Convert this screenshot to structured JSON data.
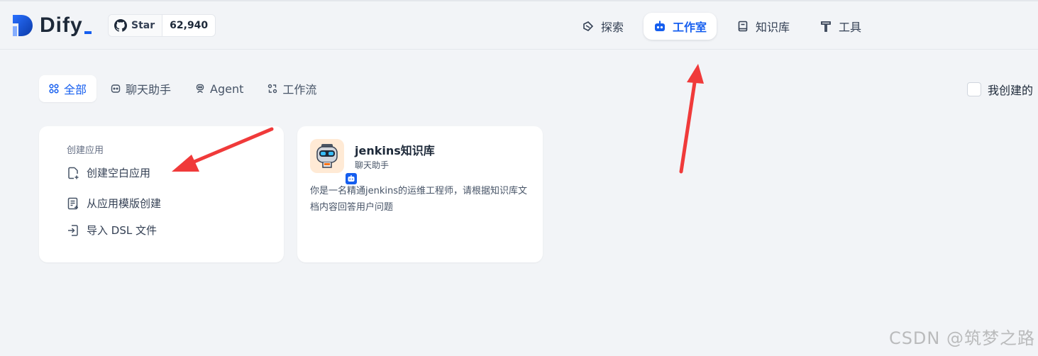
{
  "header": {
    "logo_text": "Dify",
    "github": {
      "star_label": "Star",
      "star_count": "62,940"
    },
    "nav": [
      {
        "label": "探索",
        "icon": "compass-icon",
        "active": false
      },
      {
        "label": "工作室",
        "icon": "robot-icon",
        "active": true
      },
      {
        "label": "知识库",
        "icon": "book-icon",
        "active": false
      },
      {
        "label": "工具",
        "icon": "hammer-icon",
        "active": false
      }
    ]
  },
  "tabs": [
    {
      "label": "全部",
      "icon": "grid-icon",
      "active": true
    },
    {
      "label": "聊天助手",
      "icon": "chat-icon",
      "active": false
    },
    {
      "label": "Agent",
      "icon": "agent-icon",
      "active": false
    },
    {
      "label": "工作流",
      "icon": "workflow-icon",
      "active": false
    }
  ],
  "filter": {
    "mine_label": "我创建的",
    "checked": false
  },
  "create_card": {
    "title": "创建应用",
    "items": [
      {
        "label": "创建空白应用",
        "icon": "file-plus-icon"
      },
      {
        "label": "从应用模版创建",
        "icon": "template-icon"
      },
      {
        "label": "导入 DSL 文件",
        "icon": "import-icon"
      }
    ]
  },
  "app_card": {
    "name": "jenkins知识库",
    "type": "聊天助手",
    "description": "你是一名精通jenkins的运维工程师，请根据知识库文档内容回答用户问题"
  },
  "watermark": "CSDN @筑梦之路",
  "colors": {
    "accent": "#155eef",
    "background": "#f2f4f7",
    "arrow": "#f03a3a"
  }
}
